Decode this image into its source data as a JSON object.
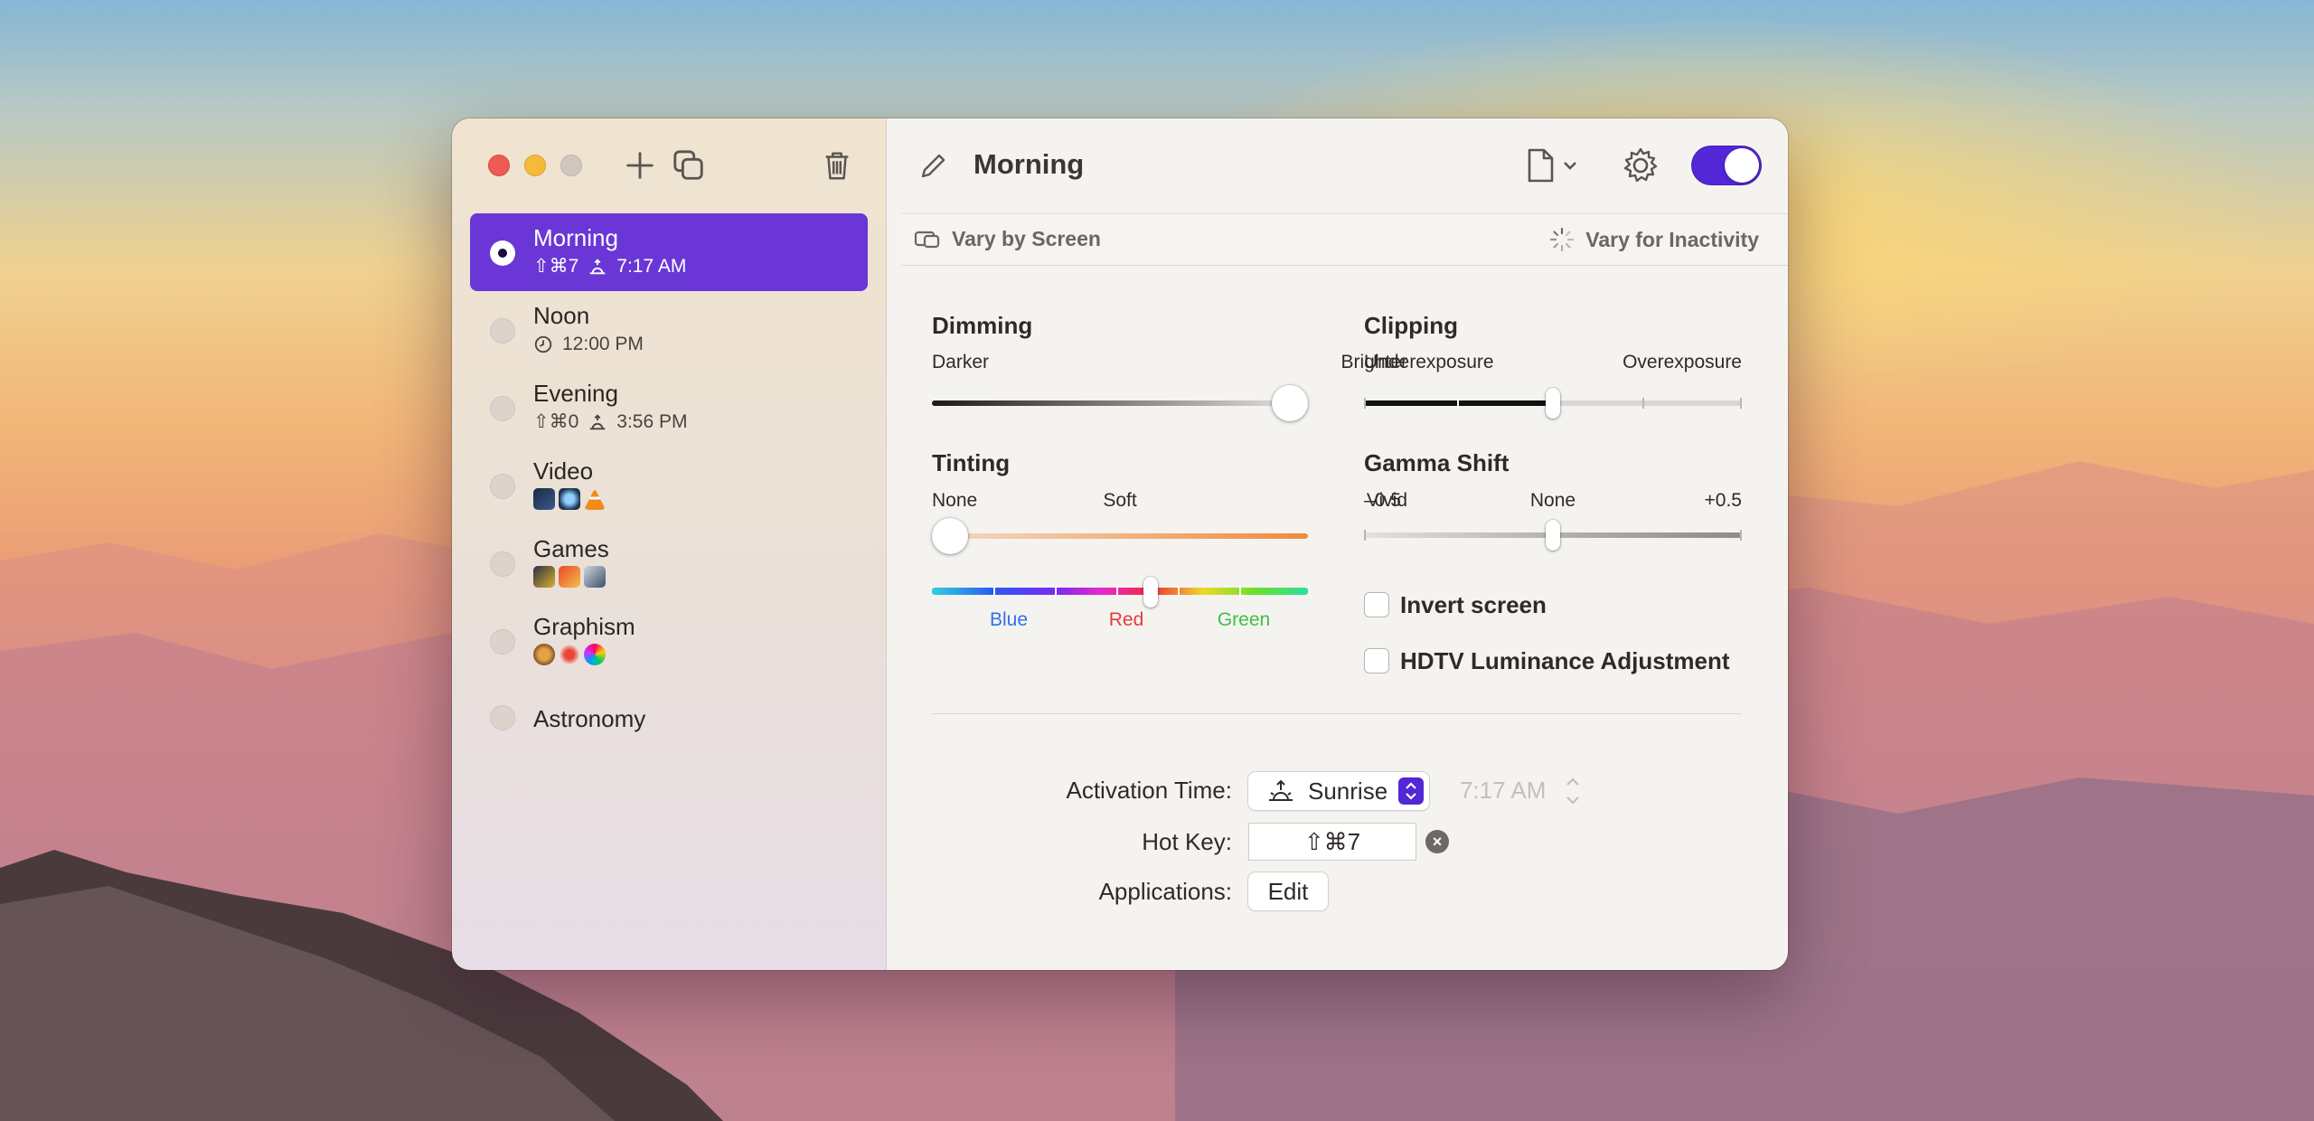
{
  "window": {
    "title": "Morning"
  },
  "toolbar": {
    "add_icon": "plus-icon",
    "duplicate_icon": "duplicate-icon",
    "delete_icon": "trash-icon"
  },
  "profiles": [
    {
      "name": "Morning",
      "shortcut": "⇧⌘7",
      "time": "7:17 AM",
      "trigger_icon": "sunrise-icon",
      "selected": true
    },
    {
      "name": "Noon",
      "time": "12:00 PM",
      "trigger_icon": "clock-icon",
      "selected": false
    },
    {
      "name": "Evening",
      "shortcut": "⇧⌘0",
      "time": "3:56 PM",
      "trigger_icon": "sunrise-icon",
      "selected": false
    },
    {
      "name": "Video",
      "apps": [
        "quicktime-app-icon",
        "screenium-app-icon",
        "vlc-app-icon"
      ],
      "selected": false
    },
    {
      "name": "Games",
      "apps": [
        "game-app-icon-1",
        "game-app-icon-2",
        "game-app-icon-3"
      ],
      "selected": false
    },
    {
      "name": "Graphism",
      "apps": [
        "graphics-app-icon-1",
        "graphics-app-icon-2",
        "graphics-app-icon-3"
      ],
      "selected": false
    },
    {
      "name": "Astronomy",
      "selected": false
    }
  ],
  "header": {
    "vary_by_screen": "Vary by Screen",
    "vary_for_inactivity": "Vary for Inactivity",
    "enabled": true
  },
  "dimming": {
    "title": "Dimming",
    "min_label": "Darker",
    "max_label": "Brighter",
    "value": 1.0
  },
  "clipping": {
    "title": "Clipping",
    "min_label": "Underexposure",
    "max_label": "Overexposure",
    "value": 0.5
  },
  "tinting": {
    "title": "Tinting",
    "labels": [
      "None",
      "Soft",
      "Vivid"
    ],
    "value": 0.0,
    "hue_labels": [
      "Blue",
      "Red",
      "Green"
    ],
    "hue_value": 0.58,
    "colors": {
      "blue": "#2f6fe8",
      "red": "#e23c3c",
      "green": "#3cc04a"
    }
  },
  "gamma": {
    "title": "Gamma Shift",
    "labels": [
      "–0.5",
      "None",
      "+0.5"
    ],
    "value": 0.5
  },
  "options": {
    "invert_screen": {
      "label": "Invert screen",
      "checked": false
    },
    "hdtv": {
      "label": "HDTV Luminance Adjustment",
      "checked": false
    }
  },
  "form": {
    "activation_label": "Activation Time:",
    "activation_value": "Sunrise",
    "activation_time": "7:17 AM",
    "hotkey_label": "Hot Key:",
    "hotkey_value": "⇧⌘7",
    "applications_label": "Applications:",
    "edit_label": "Edit"
  },
  "accent_color": "#6a37d6"
}
